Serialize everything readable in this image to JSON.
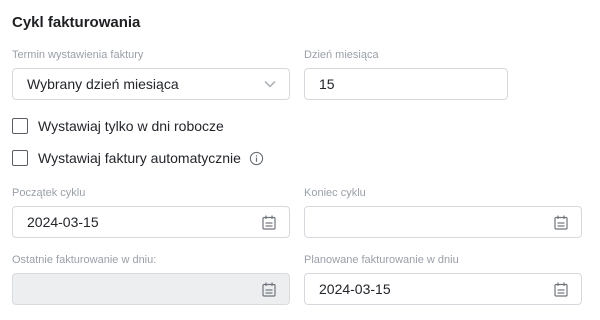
{
  "section": {
    "title": "Cykl fakturowania"
  },
  "invoice_term": {
    "label": "Termin wystawienia faktury",
    "value": "Wybrany dzień miesiąca"
  },
  "day_of_month": {
    "label": "Dzień miesiąca",
    "value": "15"
  },
  "checkboxes": {
    "working_days": {
      "label": "Wystawiaj tylko w dni robocze",
      "checked": false
    },
    "auto_invoices": {
      "label": "Wystawiaj faktury automatycznie",
      "checked": false
    }
  },
  "cycle_start": {
    "label": "Początek cyklu",
    "value": "2024-03-15"
  },
  "cycle_end": {
    "label": "Koniec cyklu",
    "value": ""
  },
  "last_invoicing": {
    "label": "Ostatnie fakturowanie w dniu:",
    "value": ""
  },
  "planned_invoicing": {
    "label": "Planowane fakturowanie w dniu",
    "value": "2024-03-15"
  },
  "icons": {
    "calendar": "calendar-icon",
    "chevron": "chevron-down-icon",
    "info": "info-icon"
  },
  "colors": {
    "border": "#d5d9de",
    "label": "#9aa0a8",
    "disabled_bg": "#eceef0"
  }
}
